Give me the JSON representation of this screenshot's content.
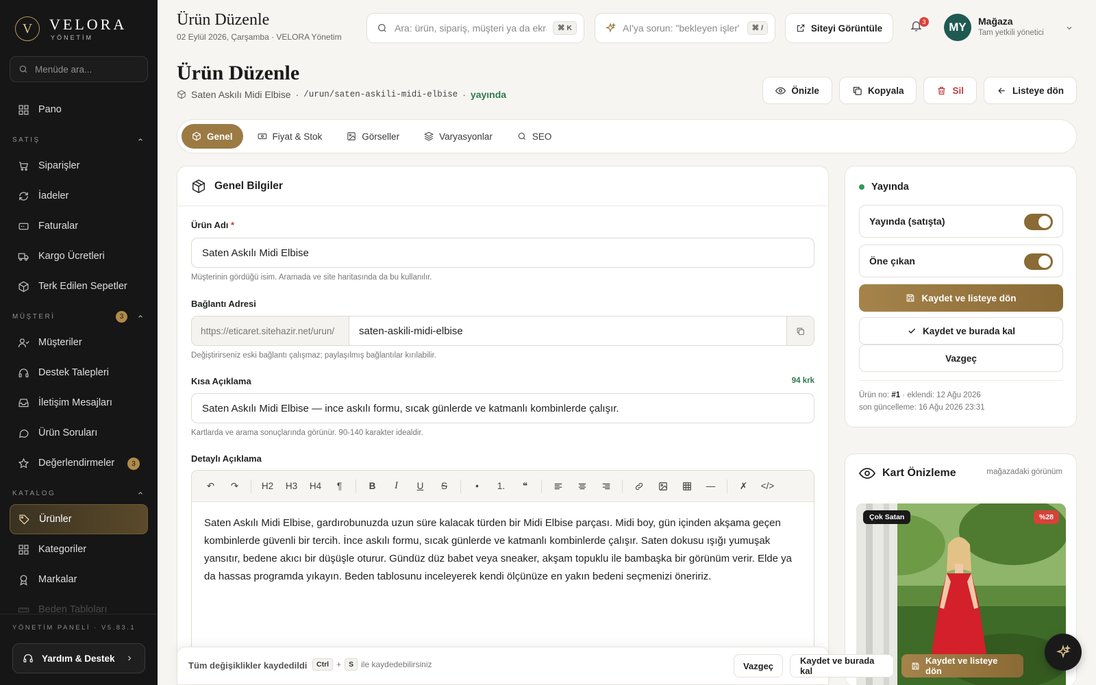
{
  "brand": {
    "name": "VELORA",
    "sub": "YÖNETİM",
    "mark": "V"
  },
  "sidebar": {
    "search_placeholder": "Menüde ara...",
    "home": "Pano",
    "sections": [
      {
        "title": "SATIŞ",
        "badge": "",
        "items": [
          {
            "label": "Siparişler",
            "icon": "cart-icon"
          },
          {
            "label": "İadeler",
            "icon": "refresh-icon"
          },
          {
            "label": "Faturalar",
            "icon": "invoice-icon"
          },
          {
            "label": "Kargo Ücretleri",
            "icon": "truck-icon"
          },
          {
            "label": "Terk Edilen Sepetler",
            "icon": "box-icon"
          }
        ]
      },
      {
        "title": "MÜŞTERİ",
        "badge": "3",
        "items": [
          {
            "label": "Müşteriler",
            "icon": "users-icon"
          },
          {
            "label": "Destek Talepleri",
            "icon": "headset-icon"
          },
          {
            "label": "İletişim Mesajları",
            "icon": "inbox-icon"
          },
          {
            "label": "Ürün Soruları",
            "icon": "chat-icon"
          },
          {
            "label": "Değerlendirmeler",
            "icon": "star-icon",
            "badge": "3"
          }
        ]
      },
      {
        "title": "KATALOG",
        "badge": "",
        "items": [
          {
            "label": "Ürünler",
            "icon": "tag-icon",
            "active": true
          },
          {
            "label": "Kategoriler",
            "icon": "grid-icon"
          },
          {
            "label": "Markalar",
            "icon": "award-icon"
          },
          {
            "label": "Beden Tabloları",
            "icon": "ruler-icon"
          }
        ]
      }
    ],
    "version": "YÖNETİM PANELİ · V5.83.1",
    "help": "Yardım & Destek"
  },
  "topbar": {
    "title": "Ürün Düzenle",
    "subtitle": "02 Eylül 2026, Çarşamba · VELORA Yönetim",
    "search_placeholder": "Ara: ürün, sipariş, müşteri ya da ekran",
    "search_kbd": "⌘ K",
    "ai_placeholder": "AI'ya sorun: \"bekleyen işler\"",
    "ai_kbd": "⌘ /",
    "view_site": "Siteyi Görüntüle",
    "notif_count": "3",
    "user_initials": "MY",
    "user_name": "Mağaza",
    "user_role": "Tam yetkili yönetici"
  },
  "page": {
    "title": "Ürün Düzenle",
    "product_name": "Saten Askılı Midi Elbise",
    "slug_path": "/urun/saten-askili-midi-elbise",
    "status": "yayında",
    "actions": {
      "preview": "Önizle",
      "copy": "Kopyala",
      "delete": "Sil",
      "back": "Listeye dön"
    }
  },
  "tabs": [
    {
      "label": "Genel",
      "icon": "box-icon",
      "active": true
    },
    {
      "label": "Fiyat & Stok",
      "icon": "money-icon"
    },
    {
      "label": "Görseller",
      "icon": "image-icon"
    },
    {
      "label": "Varyasyonlar",
      "icon": "layers-icon"
    },
    {
      "label": "SEO",
      "icon": "search-icon"
    }
  ],
  "form": {
    "card_title": "Genel Bilgiler",
    "name_label": "Ürün Adı",
    "name_value": "Saten Askılı Midi Elbise",
    "name_hint": "Müşterinin gördüğü isim. Aramada ve site haritasında da bu kullanılır.",
    "url_label": "Bağlantı Adresi",
    "url_prefix": "https://eticaret.sitehazir.net/urun/",
    "url_value": "saten-askili-midi-elbise",
    "url_hint": "Değiştirirseniz eski bağlantı çalışmaz; paylaşılmış bağlantılar kırılabilir.",
    "short_label": "Kısa Açıklama",
    "short_count": "94 krk",
    "short_value": "Saten Askılı Midi Elbise — ince askılı formu, sıcak günlerde ve katmanlı kombinlerde çalışır.",
    "short_hint": "Kartlarda ve arama sonuçlarında görünür. 90-140 karakter idealdir.",
    "detail_label": "Detaylı Açıklama",
    "toolbar": [
      "↶",
      "↷",
      "H2",
      "H3",
      "H4",
      "¶",
      "B",
      "I",
      "U",
      "S",
      "•",
      "1.",
      "❝",
      "≡l",
      "≡c",
      "≡r",
      "link",
      "img",
      "table",
      "—",
      "✗",
      "</>"
    ],
    "detail_text": "Saten Askılı Midi Elbise, gardırobunuzda uzun süre kalacak türden bir Midi Elbise parçası. Midi boy, gün içinden akşama geçen kombinlerde güvenli bir tercih. İnce askılı formu, sıcak günlerde ve katmanlı kombinlerde çalışır. Saten dokusu ışığı yumuşak yansıtır, bedene akıcı bir düşüşle oturur. Gündüz düz babet veya sneaker, akşam topuklu ile bambaşka bir görünüm verir. Elde ya da hassas programda yıkayın. Beden tablosunu inceleyerek kendi ölçünüze en yakın bedeni seçmenizi öneririz."
  },
  "publish": {
    "title": "Yayında",
    "toggle_live": "Yayında (satışta)",
    "toggle_featured": "Öne çıkan",
    "save_back": "Kaydet ve listeye dön",
    "save_stay": "Kaydet ve burada kal",
    "cancel": "Vazgeç",
    "meta_prefix": "Ürün no: ",
    "meta_id": "#1",
    "meta_added": " · eklendi: 12 Ağu 2026",
    "meta_updated": "son güncelleme: 16 Ağu 2026 23:31"
  },
  "preview": {
    "title": "Kart Önizleme",
    "sub": "mağazadaki görünüm",
    "badge": "Çok Satan",
    "discount": "%28"
  },
  "bottom": {
    "saved": "Tüm değişiklikler kaydedildi",
    "key1": "Ctrl",
    "plus": "+",
    "key2": "S",
    "shortcut_text": "ile kaydedebilirsiniz",
    "cancel": "Vazgeç",
    "save_stay": "Kaydet ve burada kal",
    "save_back": "Kaydet ve listeye dön"
  },
  "colors": {
    "accent": "#9b7a44",
    "sidebar_bg": "#161616",
    "success": "#2f7a4d",
    "danger": "#c23a3a"
  }
}
